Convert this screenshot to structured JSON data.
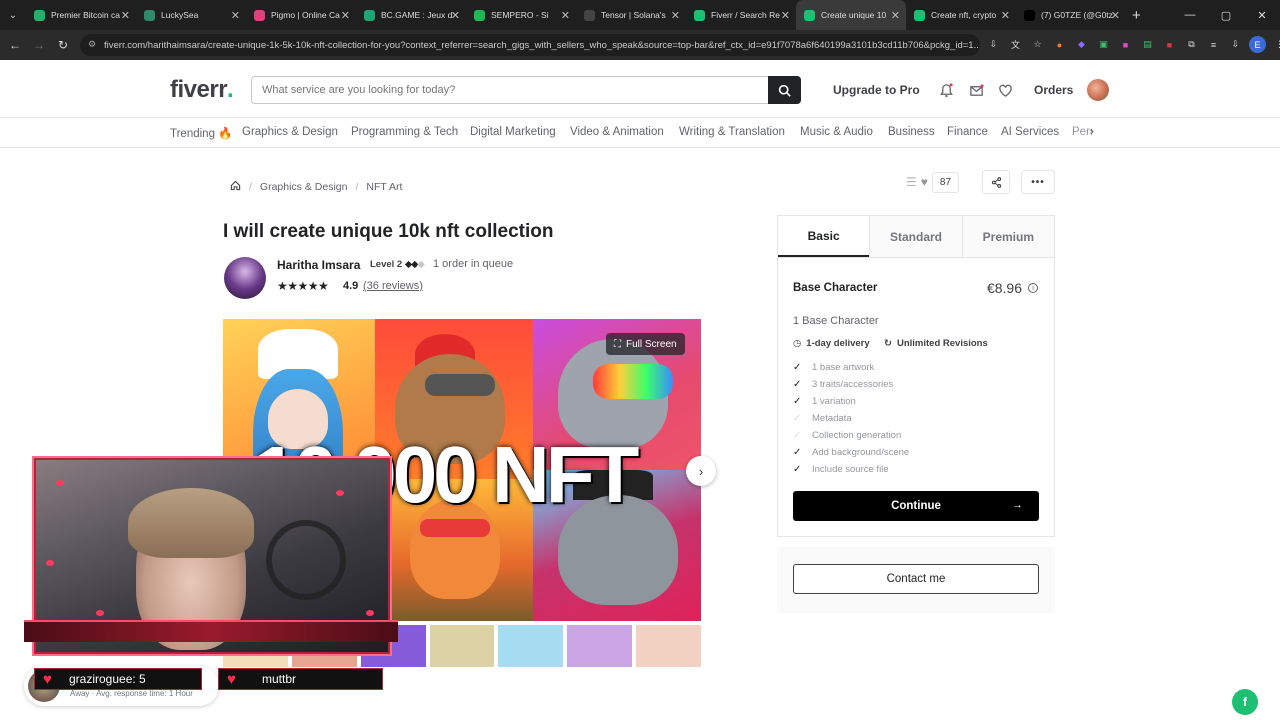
{
  "browser": {
    "tabs": [
      {
        "title": "Premier Bitcoin ca",
        "color": "#20b26b",
        "active": false
      },
      {
        "title": "LuckySea",
        "color": "#2d8a6a",
        "active": false
      },
      {
        "title": "Pigmo | Online Ca",
        "color": "#e0417e",
        "active": false
      },
      {
        "title": "BC.GAME : Jeux d",
        "color": "#1ea672",
        "active": false
      },
      {
        "title": "SEMPERO - Si",
        "color": "#1db954",
        "active": false
      },
      {
        "title": "Tensor | Solana's",
        "color": "#444444",
        "active": false
      },
      {
        "title": "Fiverr / Search Re",
        "color": "#1dbf73",
        "active": false
      },
      {
        "title": "Create unique 10",
        "color": "#1dbf73",
        "active": true
      },
      {
        "title": "Create nft, crypto",
        "color": "#1dbf73",
        "active": false
      },
      {
        "title": "(7) G0TZE (@G0tz",
        "color": "#000000",
        "active": false
      }
    ],
    "url": "fiverr.com/harithaimsara/create-unique-1k-5k-10k-nft-collection-for-you?context_referrer=search_gigs_with_sellers_who_speak&source=top-bar&ref_ctx_id=e91f7078a6f640199a3101b3cd11b706&pckg_id=1..."
  },
  "header": {
    "logo": "fiverr",
    "logo_dot": ".",
    "search_placeholder": "What service are you looking for today?",
    "upgrade": "Upgrade to Pro",
    "orders": "Orders"
  },
  "categories": [
    "Trending 🔥",
    "Graphics & Design",
    "Programming & Tech",
    "Digital Marketing",
    "Video & Animation",
    "Writing & Translation",
    "Music & Audio",
    "Business",
    "Finance",
    "AI Services",
    "Pers"
  ],
  "breadcrumb": {
    "level1": "Graphics & Design",
    "level2": "NFT Art"
  },
  "gig": {
    "title": "I will create unique 10k nft collection",
    "like_count": "87",
    "seller_name": "Haritha Imsara",
    "level": "Level 2",
    "queue": "1 order in queue",
    "rating": "4.9",
    "reviews": "(36 reviews)",
    "image_text": "10,000 NFT",
    "fullscreen": "Full Screen"
  },
  "package": {
    "tabs": [
      "Basic",
      "Standard",
      "Premium"
    ],
    "name": "Base Character",
    "price": "€8.96",
    "description": "1 Base Character",
    "delivery": "1-day delivery",
    "revisions": "Unlimited Revisions",
    "features": [
      {
        "label": "1 base artwork",
        "included": true
      },
      {
        "label": "3 traits/accessories",
        "included": true
      },
      {
        "label": "1 variation",
        "included": true
      },
      {
        "label": "Metadata",
        "included": false
      },
      {
        "label": "Collection generation",
        "included": false
      },
      {
        "label": "Add background/scene",
        "included": true
      },
      {
        "label": "Include source file",
        "included": true
      }
    ],
    "continue": "Continue",
    "contact": "Contact me"
  },
  "stream_overlay": {
    "chat1": "graziroguee: 5",
    "chat2": "muttbr",
    "away_text": "Away · Avg. response time: 1 Hour"
  }
}
